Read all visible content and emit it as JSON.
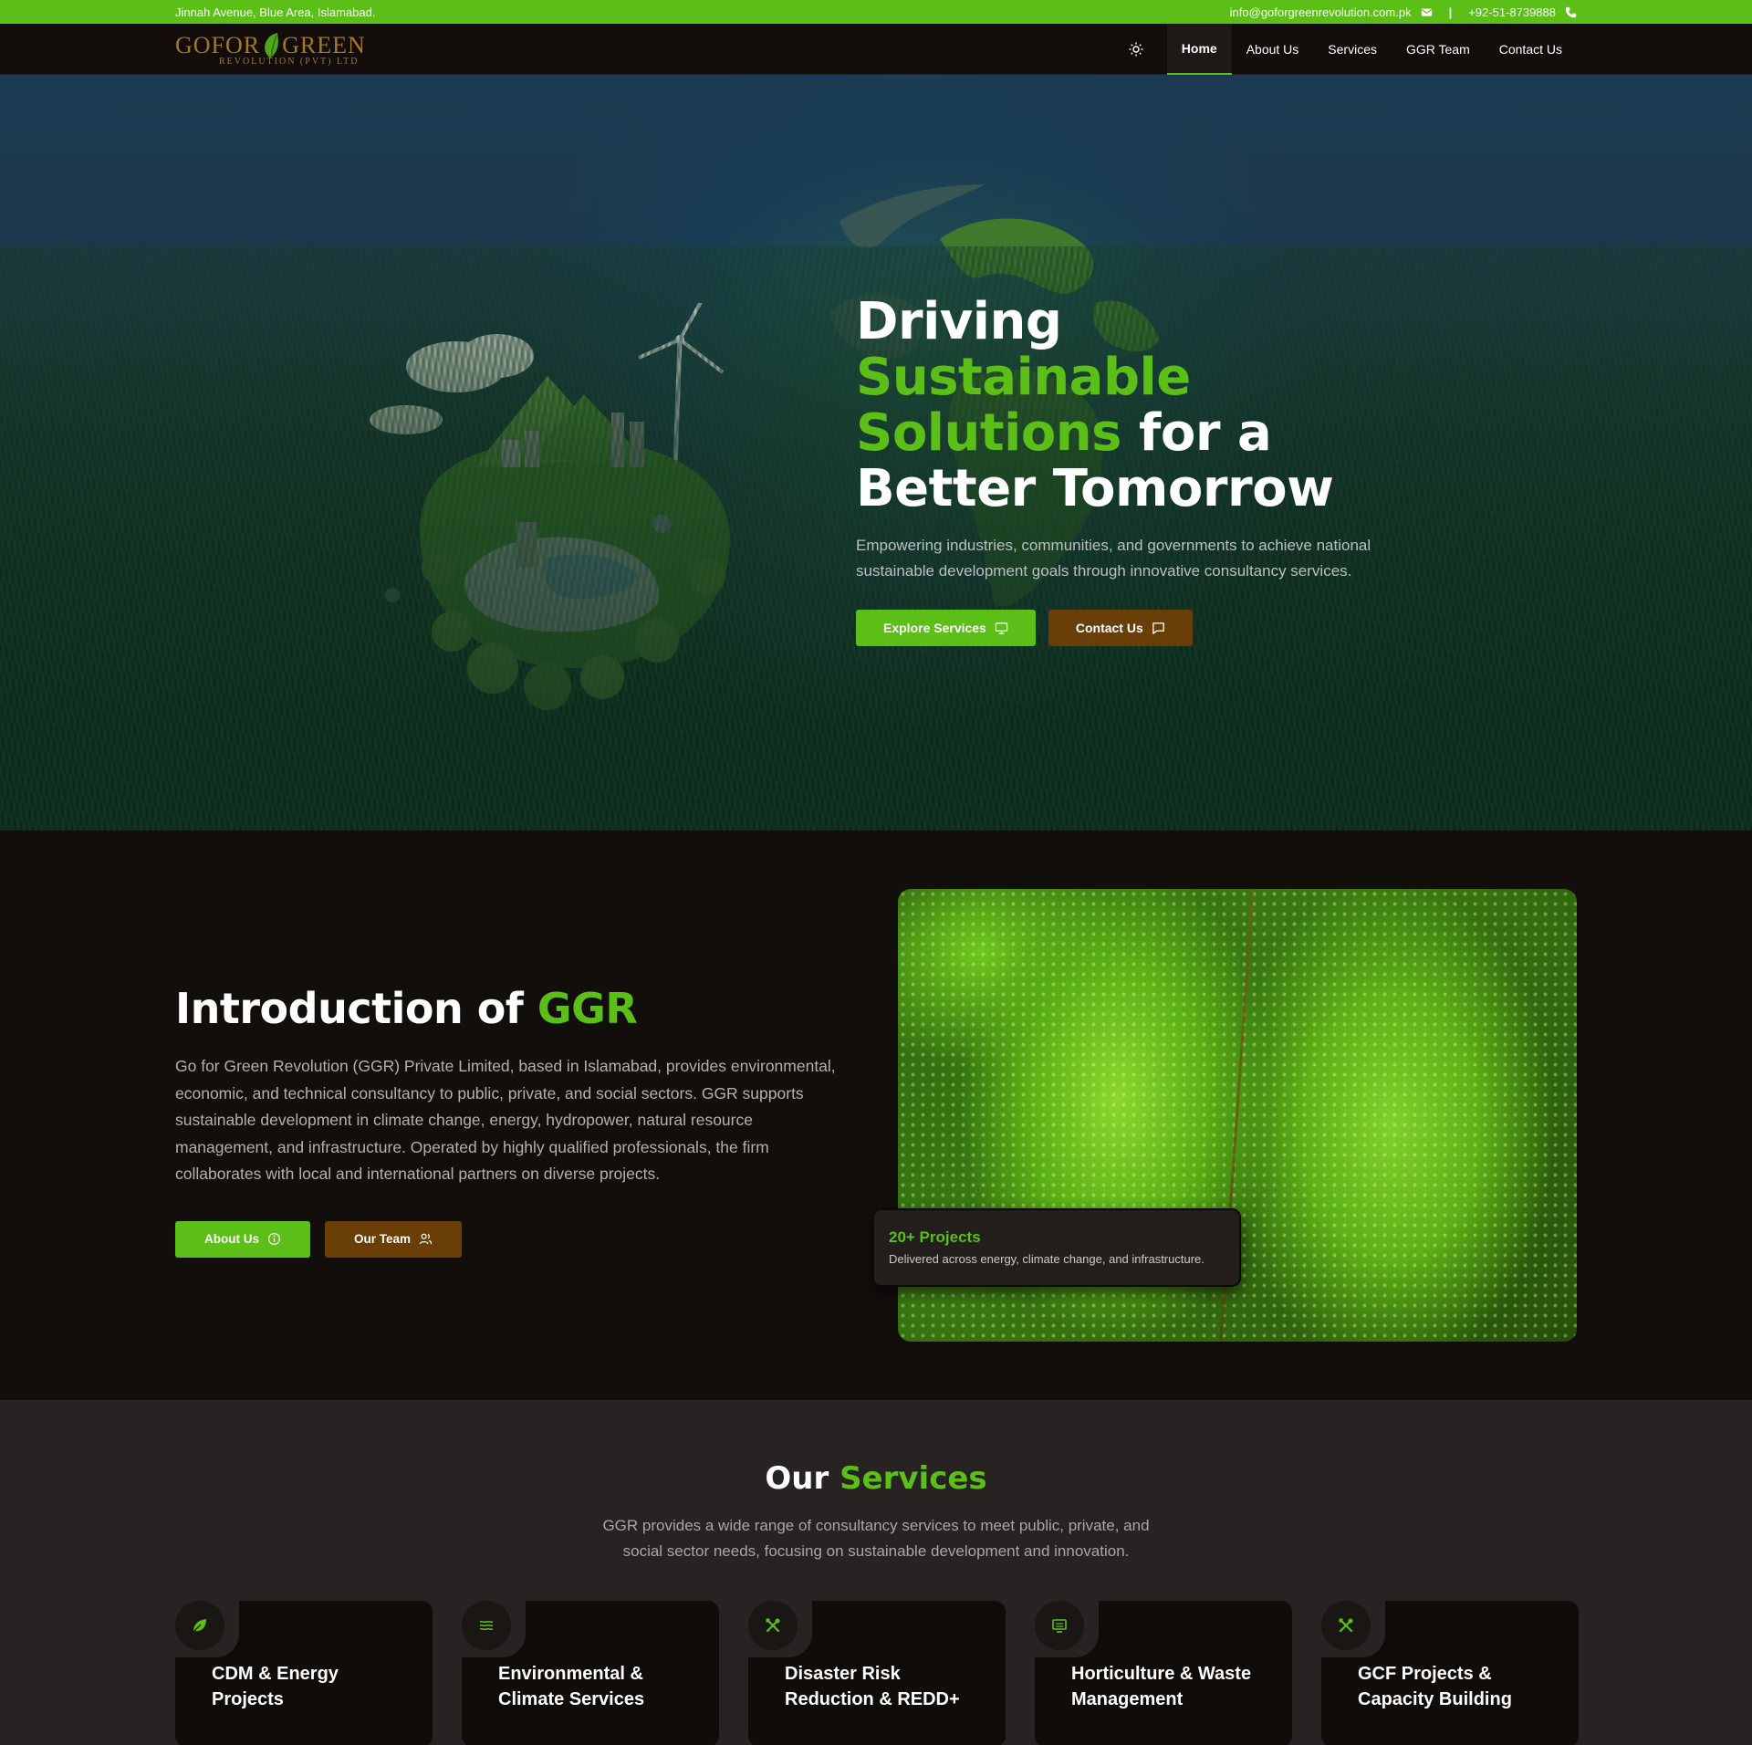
{
  "topbar": {
    "address": "Jinnah Avenue, Blue Area, Islamabad.",
    "email": "info@goforgreenrevolution.com.pk",
    "separator": "|",
    "phone": "+92-51-8739888"
  },
  "logo": {
    "main_left": "GOFOR",
    "main_right": "GREEN",
    "sub": "REVOLUTION (PVT) LTD"
  },
  "nav": {
    "theme_icon": "sun-icon",
    "items": [
      {
        "label": "Home",
        "active": true
      },
      {
        "label": "About Us"
      },
      {
        "label": "Services"
      },
      {
        "label": "GGR Team"
      },
      {
        "label": "Contact Us"
      }
    ]
  },
  "hero": {
    "title_part1": "Driving ",
    "title_green": "Sustainable Solutions",
    "title_part2": " for a Better Tomorrow",
    "subtitle": "Empowering industries, communities, and governments to achieve national sustainable development goals through innovative consultancy services.",
    "btn_primary": "Explore Services",
    "btn_primary_icon": "monitor-icon",
    "btn_secondary": "Contact Us",
    "btn_secondary_icon": "message-icon"
  },
  "intro": {
    "title_part1": "Introduction of ",
    "title_green": "GGR",
    "body": "Go for Green Revolution (GGR) Private Limited, based in Islamabad, provides environmental, economic, and technical consultancy to public, private, and social sectors. GGR supports sustainable development in climate change, energy, hydropower, natural resource management, and infrastructure. Operated by highly qualified professionals, the firm collaborates with local and international partners on diverse projects.",
    "btn_about": "About Us",
    "btn_team": "Our Team",
    "stat_number": "20+ Projects",
    "stat_desc": "Delivered across energy, climate change, and infrastructure."
  },
  "services": {
    "title_part1": "Our ",
    "title_green": "Services",
    "subtitle": "GGR provides a wide range of consultancy services to meet public, private, and social sector needs, focusing on sustainable development and innovation.",
    "cards": [
      {
        "title": "CDM & Energy Projects",
        "icon": "leaf-icon"
      },
      {
        "title": "Environmental & Climate Services",
        "icon": "waves-icon"
      },
      {
        "title": "Disaster Risk Reduction & REDD+",
        "icon": "tools-icon"
      },
      {
        "title": "Horticulture & Waste Management",
        "icon": "monitor-icon"
      },
      {
        "title": "GCF Projects & Capacity Building",
        "icon": "tools-icon"
      }
    ]
  },
  "colors": {
    "accent": "#5cbf18",
    "brown": "#6a3f07",
    "dark": "#120e0c"
  }
}
